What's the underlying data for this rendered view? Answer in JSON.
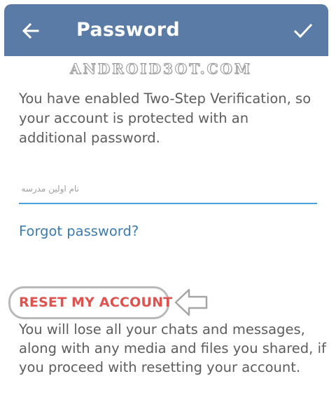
{
  "header": {
    "title": "Password",
    "back_icon": "arrow-left-icon",
    "done_icon": "checkmark-icon",
    "background": "#5a7ba5"
  },
  "watermark": "ANDROID3OT.COM",
  "description": "You have enabled Two-Step Verification, so your account is protected with an additional password.",
  "password_field": {
    "value": "",
    "placeholder": "نام اولین مدرسه",
    "underline_color": "#4aa3dc"
  },
  "forgot_link": "Forgot password?",
  "reset": {
    "label": "RESET MY ACCOUNT",
    "color": "#e0524d",
    "pointer_icon": "arrow-pointing-left-icon"
  },
  "warning": "You will lose all your chats and messages, along with any media and files you shared, if you proceed with resetting your account."
}
